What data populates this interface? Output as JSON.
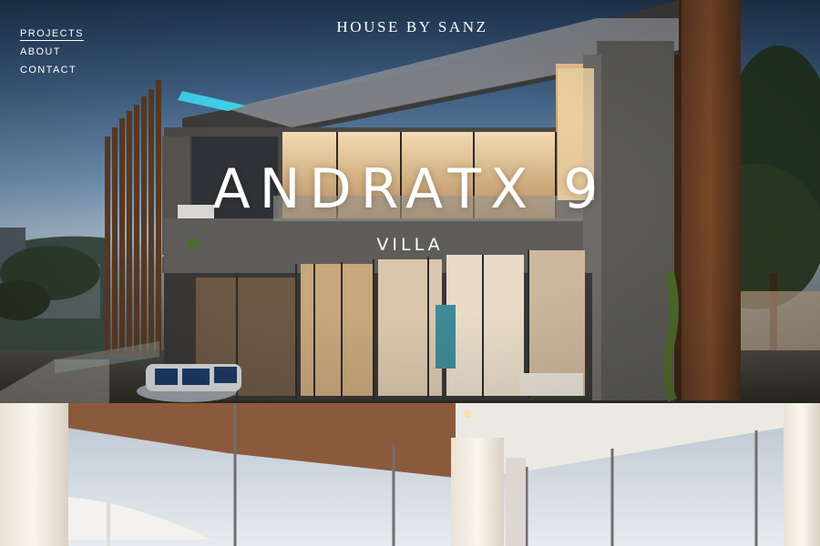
{
  "nav": {
    "items": [
      {
        "label": "PROJECTS",
        "active": true
      },
      {
        "label": "ABOUT",
        "active": false
      },
      {
        "label": "CONTACT",
        "active": false
      }
    ]
  },
  "brand": {
    "name": "HOUSE BY SANZ"
  },
  "hero": {
    "title": "ANDRATX 9",
    "subtitle": "VILLA"
  },
  "colors": {
    "text": "#ffffff",
    "accent_pool": "#3fd2e8"
  }
}
